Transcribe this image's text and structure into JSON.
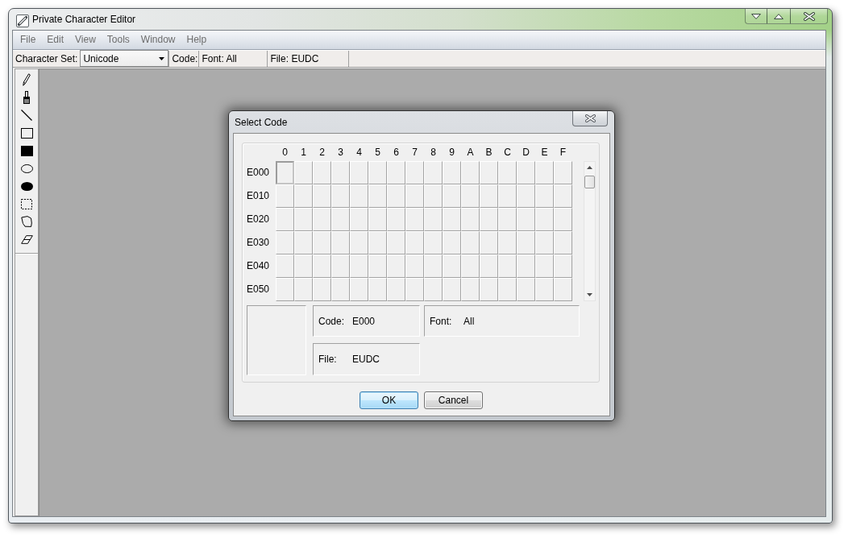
{
  "window": {
    "title": "Private Character Editor"
  },
  "menu": [
    {
      "label": "File",
      "disabled": true
    },
    {
      "label": "Edit",
      "disabled": true
    },
    {
      "label": "View",
      "disabled": true
    },
    {
      "label": "Tools",
      "disabled": true
    },
    {
      "label": "Window",
      "disabled": true
    },
    {
      "label": "Help",
      "disabled": true
    }
  ],
  "toolbar": {
    "character_set_label": "Character Set:",
    "character_set": "Unicode",
    "fields": [
      "Code:",
      "Font: All",
      "File: EUDC"
    ]
  },
  "tools": [
    {
      "kind": "pencil"
    },
    {
      "kind": "brush"
    },
    {
      "kind": "line"
    },
    {
      "kind": "hollowrect"
    },
    {
      "kind": "filledrect"
    },
    {
      "kind": "hollowoval"
    },
    {
      "kind": "filledoval"
    },
    {
      "kind": "rectselect"
    },
    {
      "kind": "freeselect"
    },
    {
      "kind": "eraser"
    }
  ],
  "dialog": {
    "title": "Select Code",
    "columns": [
      "0",
      "1",
      "2",
      "3",
      "4",
      "5",
      "6",
      "7",
      "8",
      "9",
      "A",
      "B",
      "C",
      "D",
      "E",
      "F"
    ],
    "rows": [
      {
        "label": "E000",
        "cells": [
          {
            "selected": true
          },
          {
            "selected": false
          },
          {
            "selected": false
          },
          {
            "selected": false
          },
          {
            "selected": false
          },
          {
            "selected": false
          },
          {
            "selected": false
          },
          {
            "selected": false
          },
          {
            "selected": false
          },
          {
            "selected": false
          },
          {
            "selected": false
          },
          {
            "selected": false
          },
          {
            "selected": false
          },
          {
            "selected": false
          },
          {
            "selected": false
          },
          {
            "selected": false
          }
        ]
      },
      {
        "label": "E010",
        "cells": [
          {
            "selected": false
          },
          {
            "selected": false
          },
          {
            "selected": false
          },
          {
            "selected": false
          },
          {
            "selected": false
          },
          {
            "selected": false
          },
          {
            "selected": false
          },
          {
            "selected": false
          },
          {
            "selected": false
          },
          {
            "selected": false
          },
          {
            "selected": false
          },
          {
            "selected": false
          },
          {
            "selected": false
          },
          {
            "selected": false
          },
          {
            "selected": false
          },
          {
            "selected": false
          }
        ]
      },
      {
        "label": "E020",
        "cells": [
          {
            "selected": false
          },
          {
            "selected": false
          },
          {
            "selected": false
          },
          {
            "selected": false
          },
          {
            "selected": false
          },
          {
            "selected": false
          },
          {
            "selected": false
          },
          {
            "selected": false
          },
          {
            "selected": false
          },
          {
            "selected": false
          },
          {
            "selected": false
          },
          {
            "selected": false
          },
          {
            "selected": false
          },
          {
            "selected": false
          },
          {
            "selected": false
          },
          {
            "selected": false
          }
        ]
      },
      {
        "label": "E030",
        "cells": [
          {
            "selected": false
          },
          {
            "selected": false
          },
          {
            "selected": false
          },
          {
            "selected": false
          },
          {
            "selected": false
          },
          {
            "selected": false
          },
          {
            "selected": false
          },
          {
            "selected": false
          },
          {
            "selected": false
          },
          {
            "selected": false
          },
          {
            "selected": false
          },
          {
            "selected": false
          },
          {
            "selected": false
          },
          {
            "selected": false
          },
          {
            "selected": false
          },
          {
            "selected": false
          }
        ]
      },
      {
        "label": "E040",
        "cells": [
          {
            "selected": false
          },
          {
            "selected": false
          },
          {
            "selected": false
          },
          {
            "selected": false
          },
          {
            "selected": false
          },
          {
            "selected": false
          },
          {
            "selected": false
          },
          {
            "selected": false
          },
          {
            "selected": false
          },
          {
            "selected": false
          },
          {
            "selected": false
          },
          {
            "selected": false
          },
          {
            "selected": false
          },
          {
            "selected": false
          },
          {
            "selected": false
          },
          {
            "selected": false
          }
        ]
      },
      {
        "label": "E050",
        "cells": [
          {
            "selected": false
          },
          {
            "selected": false
          },
          {
            "selected": false
          },
          {
            "selected": false
          },
          {
            "selected": false
          },
          {
            "selected": false
          },
          {
            "selected": false
          },
          {
            "selected": false
          },
          {
            "selected": false
          },
          {
            "selected": false
          },
          {
            "selected": false
          },
          {
            "selected": false
          },
          {
            "selected": false
          },
          {
            "selected": false
          },
          {
            "selected": false
          },
          {
            "selected": false
          }
        ]
      }
    ],
    "info": {
      "code_label": "Code:",
      "code": "E000",
      "font_label": "Font:",
      "font": "All",
      "file_label": "File:",
      "file": "EUDC"
    },
    "buttons": [
      {
        "label": "OK",
        "default": true
      },
      {
        "label": "Cancel",
        "default": false
      }
    ]
  }
}
